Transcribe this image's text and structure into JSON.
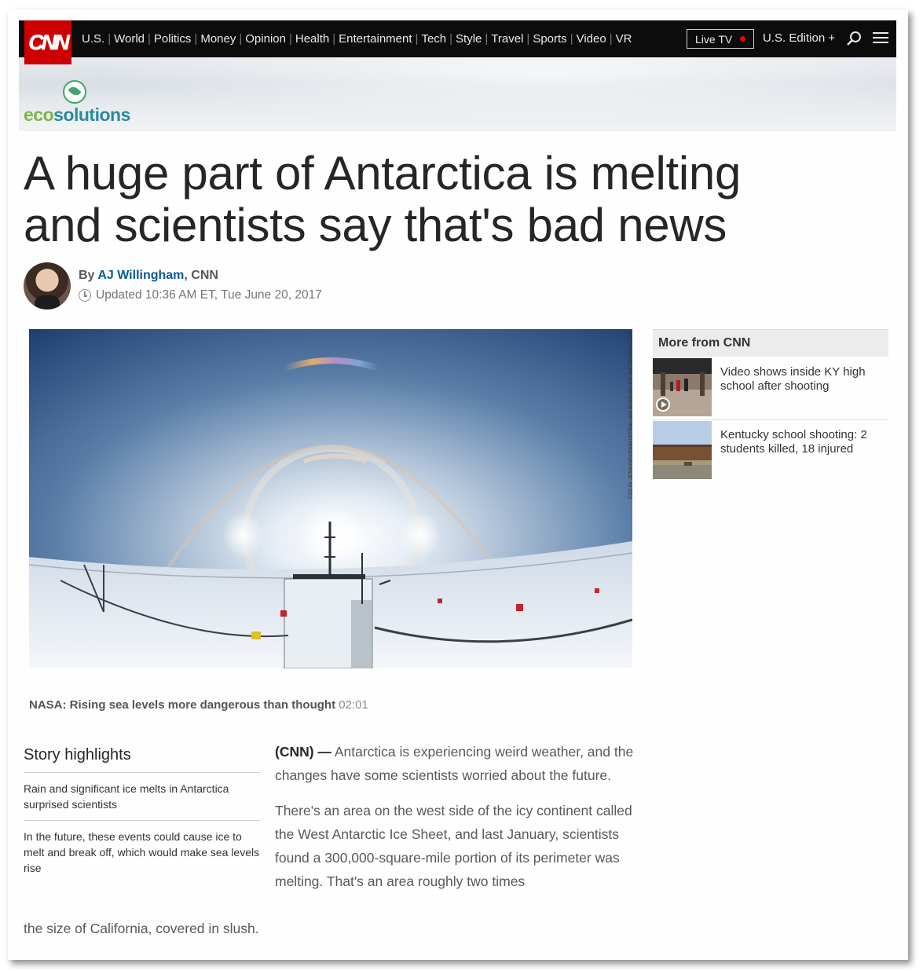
{
  "nav": {
    "logo": "CNN",
    "links": [
      "U.S.",
      "World",
      "Politics",
      "Money",
      "Opinion",
      "Health",
      "Entertainment",
      "Tech",
      "Style",
      "Travel",
      "Sports",
      "Video",
      "VR"
    ],
    "live_tv": "Live TV",
    "edition": "U.S. Edition +"
  },
  "banner": {
    "brand_a": "eco",
    "brand_b": "solutions"
  },
  "article": {
    "headline": "A huge part of Antarctica is melting and scientists say that's bad news",
    "byline_prefix": "By",
    "author": "AJ Willingham",
    "source": ", CNN",
    "updated": "Updated 10:36 AM ET, Tue June 20, 2017",
    "image_credit": "COLIN JENKINSON/AUSTRALIAN BUREAU OF METEOROLOGY",
    "video_title": "NASA: Rising sea levels more dangerous than thought",
    "video_duration": "02:01",
    "dateline": "(CNN) —",
    "para1": "Antarctica is experiencing weird weather, and the changes have some scientists worried about the future.",
    "para2": "There's an area on the west side of the icy continent called the West Antarctic Ice Sheet, and last January, scientists found a 300,000-square-mile portion of its perimeter was melting. That's an area roughly two times",
    "para2_tail": "the size of California, covered in slush."
  },
  "sidebar": {
    "header": "More from CNN",
    "items": [
      {
        "title": "Video shows inside KY high school after shooting"
      },
      {
        "title": "Kentucky school shooting: 2 students killed, 18 injured"
      }
    ]
  },
  "highlights": {
    "title": "Story highlights",
    "items": [
      "Rain and significant ice melts in Antarctica surprised scientists",
      "In the future, these events could cause ice to melt and break off, which would make sea levels rise"
    ]
  }
}
